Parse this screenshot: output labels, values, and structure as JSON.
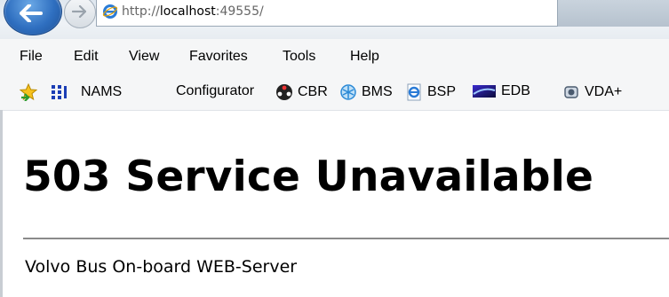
{
  "browser": {
    "address_bar": {
      "url_prefix": "http://",
      "url_host": "localhost",
      "url_port": ":49555/"
    }
  },
  "menu": {
    "items": [
      {
        "label": "File"
      },
      {
        "label": "Edit"
      },
      {
        "label": "View"
      },
      {
        "label": "Favorites"
      },
      {
        "label": "Tools"
      },
      {
        "label": "Help"
      }
    ]
  },
  "favorites_bar": {
    "items": [
      {
        "label": "NAMS",
        "icon": "nams-icon"
      },
      {
        "label": "Configurator",
        "icon": ""
      },
      {
        "label": "CBR",
        "icon": "cbr-icon"
      },
      {
        "label": "BMS",
        "icon": "bms-icon"
      },
      {
        "label": "BSP",
        "icon": "ie-page-icon"
      },
      {
        "label": "EDB",
        "icon": "edb-icon"
      },
      {
        "label": "VDA+",
        "icon": "vda-icon"
      }
    ]
  },
  "page": {
    "title": "503 Service Unavailable",
    "footer": "Volvo Bus On-board WEB-Server"
  }
}
